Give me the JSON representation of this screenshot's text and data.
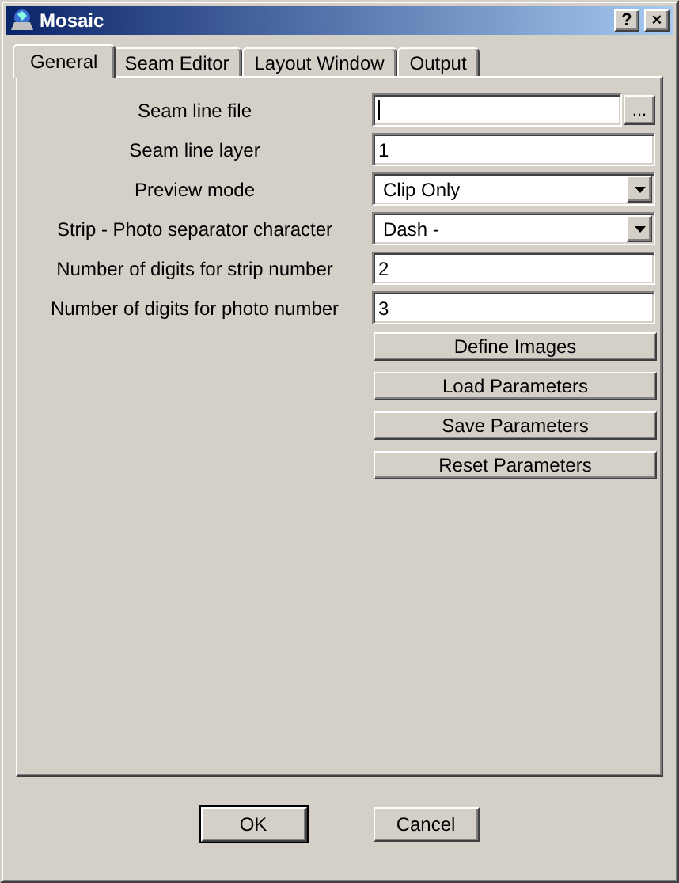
{
  "window": {
    "title": "Mosaic",
    "title_buttons": [
      "?",
      "×"
    ]
  },
  "tabs": [
    {
      "label": "General",
      "selected": true
    },
    {
      "label": "Seam Editor",
      "selected": false
    },
    {
      "label": "Layout Window",
      "selected": false
    },
    {
      "label": "Output",
      "selected": false
    }
  ],
  "fields": [
    {
      "label": "Seam line file",
      "kind": "file",
      "focused": true,
      "browse": "..."
    },
    {
      "label": "Seam line layer",
      "kind": "text",
      "value": "1"
    },
    {
      "label": "Preview mode",
      "kind": "select",
      "value": "Clip Only"
    },
    {
      "label": "Strip - Photo separator character",
      "kind": "select",
      "value": "Dash -"
    },
    {
      "label": "Number of digits for strip number",
      "kind": "text",
      "value": "2"
    },
    {
      "label": "Number of digits for photo number",
      "kind": "text",
      "value": "3"
    }
  ],
  "actions": [
    "Define Images",
    "Load Parameters",
    "Save Parameters",
    "Reset Parameters"
  ],
  "buttons": [
    "OK",
    "Cancel"
  ]
}
